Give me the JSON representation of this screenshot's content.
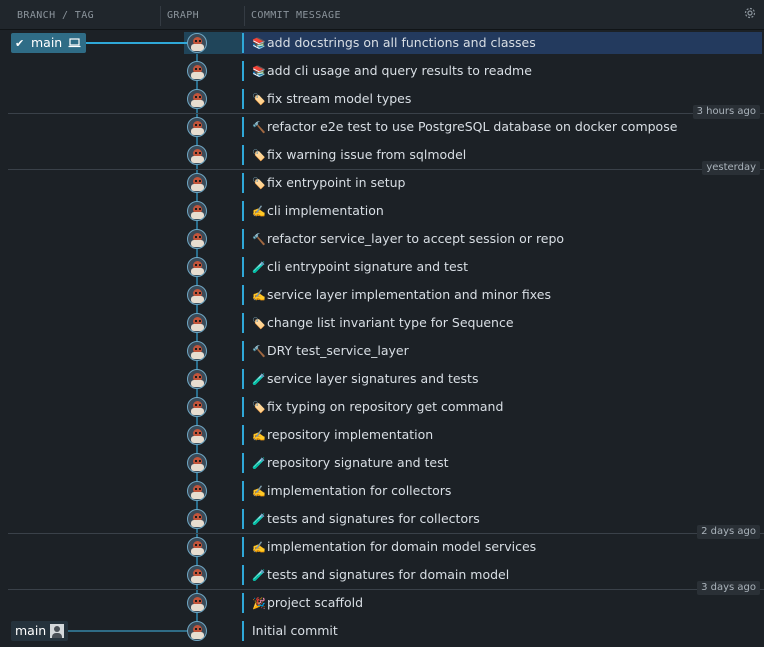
{
  "header": {
    "branch_tag": "BRANCH / TAG",
    "graph": "GRAPH",
    "commit_message": "COMMIT MESSAGE",
    "settings_icon": "gear-icon"
  },
  "branches": {
    "local": {
      "label": "main",
      "status_icon": "check-icon",
      "device_icon": "laptop-icon"
    },
    "remote": {
      "label": "main",
      "avatar_icon": "person-avatar-icon"
    }
  },
  "commits": [
    {
      "emoji": "📚",
      "icon": "books-icon",
      "message": "add docstrings on all functions and classes"
    },
    {
      "emoji": "📚",
      "icon": "books-icon",
      "message": "add cli usage and query results to readme"
    },
    {
      "emoji": "🏷️",
      "icon": "label-icon",
      "message": "fix stream model types"
    },
    {
      "emoji": "🔨",
      "icon": "hammer-icon",
      "message": "refactor e2e test to use PostgreSQL database on docker compose"
    },
    {
      "emoji": "🏷️",
      "icon": "label-icon",
      "message": "fix warning issue from sqlmodel"
    },
    {
      "emoji": "🏷️",
      "icon": "label-icon",
      "message": "fix entrypoint in setup"
    },
    {
      "emoji": "✍️",
      "icon": "writing-hand-icon",
      "message": "cli implementation"
    },
    {
      "emoji": "🔨",
      "icon": "hammer-icon",
      "message": "refactor service_layer to accept session or repo"
    },
    {
      "emoji": "🧪",
      "icon": "test-tube-icon",
      "message": "cli entrypoint signature and test"
    },
    {
      "emoji": "✍️",
      "icon": "writing-hand-icon",
      "message": "service layer implementation and minor fixes"
    },
    {
      "emoji": "🏷️",
      "icon": "label-icon",
      "message": "change list invariant type for Sequence"
    },
    {
      "emoji": "🔨",
      "icon": "hammer-icon",
      "message": "DRY test_service_layer"
    },
    {
      "emoji": "🧪",
      "icon": "test-tube-icon",
      "message": "service layer signatures and tests"
    },
    {
      "emoji": "🏷️",
      "icon": "label-icon",
      "message": "fix typing on repository get command"
    },
    {
      "emoji": "✍️",
      "icon": "writing-hand-icon",
      "message": "repository implementation"
    },
    {
      "emoji": "🧪",
      "icon": "test-tube-icon",
      "message": "repository signature and test"
    },
    {
      "emoji": "✍️",
      "icon": "writing-hand-icon",
      "message": "implementation for collectors"
    },
    {
      "emoji": "🧪",
      "icon": "test-tube-icon",
      "message": "tests and signatures for collectors"
    },
    {
      "emoji": "✍️",
      "icon": "writing-hand-icon",
      "message": "implementation for domain model services"
    },
    {
      "emoji": "🧪",
      "icon": "test-tube-icon",
      "message": "tests and signatures for domain model"
    },
    {
      "emoji": "🎉",
      "icon": "party-popper-icon",
      "message": "project scaffold"
    },
    {
      "emoji": "",
      "icon": "",
      "message": "Initial commit"
    }
  ],
  "time_labels": [
    {
      "label": "3 hours ago"
    },
    {
      "label": "yesterday"
    },
    {
      "label": "2 days ago"
    },
    {
      "label": "3 days ago"
    }
  ],
  "colors": {
    "accent": "#2fa8d8",
    "selected_row": "#233a5e",
    "branch_badge": "#2f6c86"
  }
}
